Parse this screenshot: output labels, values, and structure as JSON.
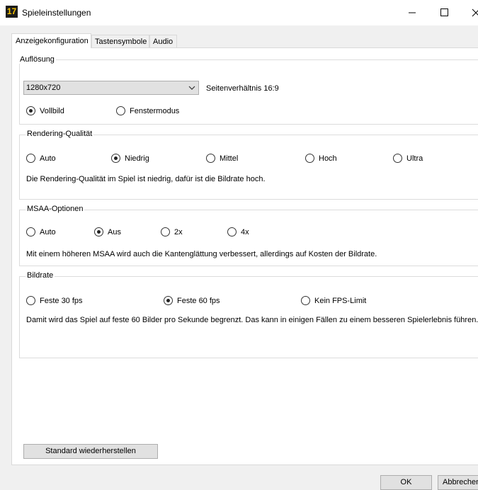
{
  "window": {
    "title": "Spieleinstellungen",
    "app_icon_text": "17"
  },
  "tabs": [
    {
      "label": "Anzeigekonfiguration"
    },
    {
      "label": "Tastensymbole"
    },
    {
      "label": "Audio"
    }
  ],
  "resolution": {
    "title": "Auflösung",
    "selected": "1280x720",
    "aspect": "Seitenverhältnis 16:9",
    "modes": [
      {
        "label": "Vollbild"
      },
      {
        "label": "Fenstermodus"
      }
    ]
  },
  "rendering": {
    "title": "Rendering-Qualität",
    "options": [
      {
        "label": "Auto"
      },
      {
        "label": "Niedrig"
      },
      {
        "label": "Mittel"
      },
      {
        "label": "Hoch"
      },
      {
        "label": "Ultra"
      }
    ],
    "description": "Die Rendering-Qualität im Spiel ist niedrig, dafür ist die Bildrate hoch."
  },
  "msaa": {
    "title": "MSAA-Optionen",
    "options": [
      {
        "label": "Auto"
      },
      {
        "label": "Aus"
      },
      {
        "label": "2x"
      },
      {
        "label": "4x"
      }
    ],
    "description": "Mit einem höheren MSAA wird auch die Kantenglättung verbessert, allerdings auf Kosten der Bildrate."
  },
  "framerate": {
    "title": "Bildrate",
    "options": [
      {
        "label": "Feste 30 fps"
      },
      {
        "label": "Feste 60 fps"
      },
      {
        "label": "Kein FPS-Limit"
      }
    ],
    "description": "Damit wird das Spiel auf feste 60 Bilder pro Sekunde begrenzt. Das kann in einigen Fällen zu einem besseren Spielerlebnis führen."
  },
  "buttons": {
    "restore": "Standard wiederherstellen",
    "ok": "OK",
    "cancel": "Abbrechen"
  }
}
